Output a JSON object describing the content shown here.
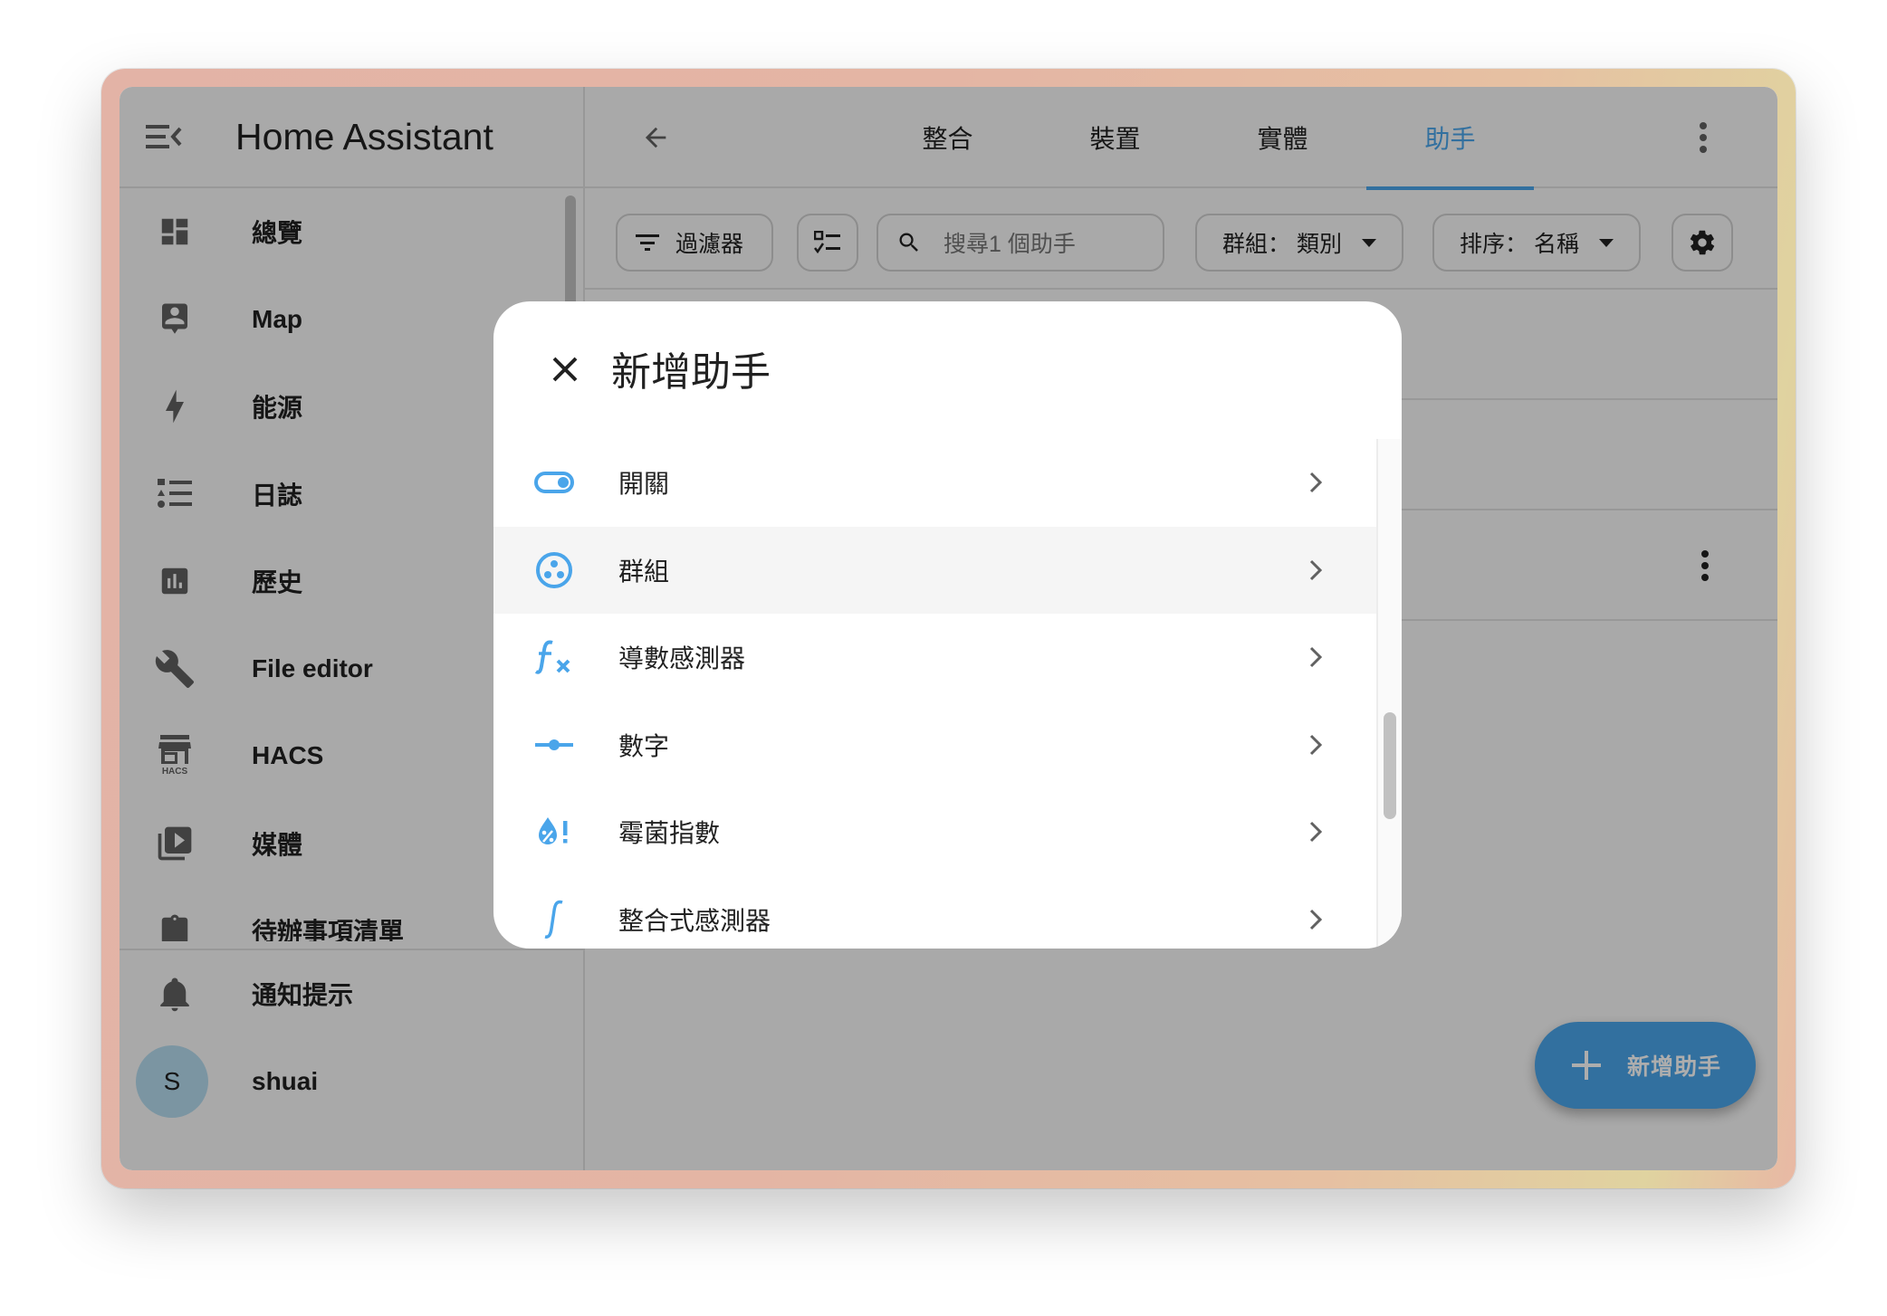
{
  "app": {
    "title": "Home Assistant"
  },
  "sidebar": {
    "items": [
      {
        "label": "總覽",
        "icon": "dashboard-icon"
      },
      {
        "label": "Map",
        "icon": "map-account-icon"
      },
      {
        "label": "能源",
        "icon": "lightning-bolt-icon"
      },
      {
        "label": "日誌",
        "icon": "logbook-list-icon"
      },
      {
        "label": "歷史",
        "icon": "chart-box-icon"
      },
      {
        "label": "File editor",
        "icon": "wrench-icon"
      },
      {
        "label": "HACS",
        "icon": "hacs-store-icon"
      },
      {
        "label": "媒體",
        "icon": "play-box-multiple-icon"
      },
      {
        "label": "待辦事項清單",
        "icon": "clipboard-list-icon"
      }
    ],
    "hacs_badge": "HACS",
    "notifications_label": "通知提示",
    "user": {
      "initial": "S",
      "name": "shuai"
    }
  },
  "header": {
    "tabs": [
      {
        "label": "整合",
        "active": false
      },
      {
        "label": "裝置",
        "active": false
      },
      {
        "label": "實體",
        "active": false
      },
      {
        "label": "助手",
        "active": true
      }
    ]
  },
  "toolbar": {
    "filter_label": "過濾器",
    "search_placeholder": "搜尋1 個助手",
    "group_label": "群組： 類別",
    "sort_label": "排序： 名稱"
  },
  "fab": {
    "label": "新增助手"
  },
  "dialog": {
    "title": "新增助手",
    "items": [
      {
        "label": "開關",
        "icon": "toggle-switch-icon"
      },
      {
        "label": "群組",
        "icon": "group-circle-icon",
        "hover": true
      },
      {
        "label": "導數感測器",
        "icon": "function-variant-icon"
      },
      {
        "label": "數字",
        "icon": "ray-vertex-icon"
      },
      {
        "label": "霉菌指數",
        "icon": "water-percent-alert-icon"
      },
      {
        "label": "整合式感測器",
        "icon": "integral-icon"
      }
    ]
  },
  "colors": {
    "accent": "#4aa5ea",
    "icon_gray": "#616161",
    "text": "#212121",
    "avatar_bg": "#b6dcef",
    "scrim": "rgba(0,0,0,0.32)"
  }
}
